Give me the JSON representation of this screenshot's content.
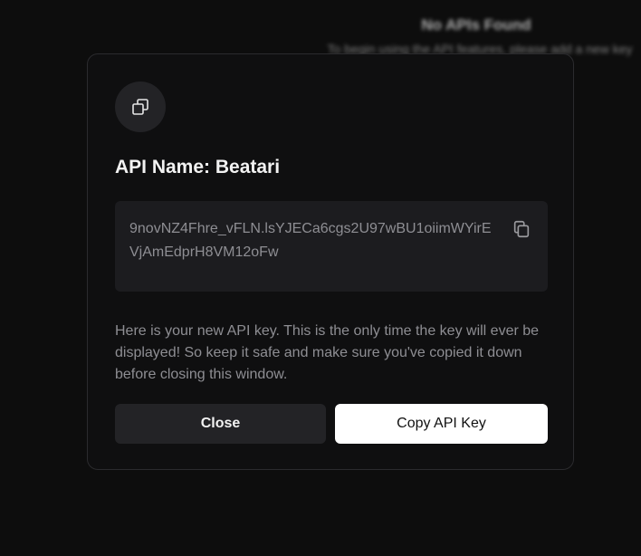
{
  "background": {
    "empty_title": "No APIs Found",
    "empty_subtitle": "To begin using the API features, please add a new key"
  },
  "modal": {
    "header_icon": "copy-icon",
    "title": "API Name: Beatari",
    "api_key": "9novNZ4Fhre_vFLN.lsYJECa6cgs2U97wBU1oiimWYirEVjAmEdprH8VM12oFw",
    "key_copy_icon": "copy-icon",
    "description": "Here is your new API key. This is the only time the key will ever be displayed! So keep it safe and make sure you've copied it down before closing this window.",
    "close_label": "Close",
    "copy_label": "Copy API Key"
  },
  "colors": {
    "page_bg": "#0d0d0d",
    "modal_bg": "#0f0f10",
    "key_box_bg": "#1c1c1f",
    "primary_button_bg": "#ffffff",
    "secondary_button_bg": "#232326"
  }
}
